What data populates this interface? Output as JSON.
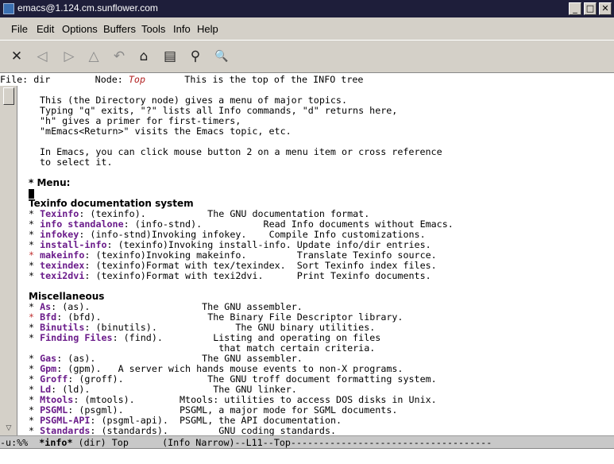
{
  "window": {
    "title": "emacs@1.124.cm.sunflower.com",
    "controls": [
      "_",
      "□",
      "✕"
    ]
  },
  "menubar": [
    "File",
    "Edit",
    "Options",
    "Buffers",
    "Tools",
    "Info",
    "Help"
  ],
  "toolbar": [
    {
      "icon": "close-icon",
      "glyph": "✕",
      "enabled": true
    },
    {
      "icon": "prev-node-icon",
      "glyph": "◁",
      "enabled": false
    },
    {
      "icon": "next-node-icon",
      "glyph": "▷",
      "enabled": false
    },
    {
      "icon": "up-node-icon",
      "glyph": "△",
      "enabled": false
    },
    {
      "icon": "back-history-icon",
      "glyph": "↶",
      "enabled": false
    },
    {
      "icon": "home-icon",
      "glyph": "⌂",
      "enabled": true
    },
    {
      "icon": "index-icon",
      "glyph": "▤",
      "enabled": true
    },
    {
      "icon": "goto-node-icon",
      "glyph": "⚲",
      "enabled": true
    },
    {
      "icon": "search-icon",
      "glyph": "🔍",
      "enabled": true
    }
  ],
  "header": {
    "file_label": "File:",
    "file": "dir",
    "node_label": "Node:",
    "node": "Top",
    "description": "This is the top of the INFO tree"
  },
  "intro": [
    "This (the Directory node) gives a menu of major topics.",
    "Typing \"q\" exits, \"?\" lists all Info commands, \"d\" returns here,",
    "\"h\" gives a primer for first-timers,",
    "\"mEmacs<Return>\" visits the Emacs topic, etc.",
    "",
    "In Emacs, you can click mouse button 2 on a menu item or cross reference",
    "to select it."
  ],
  "menu_heading": "* Menu:",
  "sections": [
    {
      "title": "Texinfo documentation system",
      "items": [
        {
          "star_red": false,
          "name": "Texinfo",
          "rest": ": (texinfo).           The GNU documentation format."
        },
        {
          "star_red": false,
          "name": "info standalone",
          "rest": ": (info-stnd).           Read Info documents without Emacs."
        },
        {
          "star_red": false,
          "name": "infokey",
          "rest": ": (info-stnd)Invoking infokey.    Compile Info customizations."
        },
        {
          "star_red": false,
          "name": "install-info",
          "rest": ": (texinfo)Invoking install-info. Update info/dir entries."
        },
        {
          "star_red": true,
          "name": "makeinfo",
          "rest": ": (texinfo)Invoking makeinfo.         Translate Texinfo source."
        },
        {
          "star_red": false,
          "name": "texindex",
          "rest": ": (texinfo)Format with tex/texindex.  Sort Texinfo index files."
        },
        {
          "star_red": false,
          "name": "texi2dvi",
          "rest": ": (texinfo)Format with texi2dvi.      Print Texinfo documents."
        }
      ]
    },
    {
      "title": "Miscellaneous",
      "items": [
        {
          "star_red": false,
          "name": "As",
          "rest": ": (as).                    The GNU assembler."
        },
        {
          "star_red": true,
          "name": "Bfd",
          "rest": ": (bfd).                   The Binary File Descriptor library."
        },
        {
          "star_red": false,
          "name": "Binutils",
          "rest": ": (binutils).              The GNU binary utilities."
        },
        {
          "star_red": false,
          "name": "Finding Files",
          "rest": ": (find).         Listing and operating on files"
        },
        {
          "star_red": false,
          "name": "",
          "rest": "                                  that match certain criteria."
        },
        {
          "star_red": false,
          "name": "Gas",
          "rest": ": (as).                   The GNU assembler."
        },
        {
          "star_red": false,
          "name": "Gpm",
          "rest": ": (gpm).   A server wich hands mouse events to non-X programs."
        },
        {
          "star_red": false,
          "name": "Groff",
          "rest": ": (groff).               The GNU troff document formatting system."
        },
        {
          "star_red": false,
          "name": "Ld",
          "rest": ": (ld).                      The GNU linker."
        },
        {
          "star_red": false,
          "name": "Mtools",
          "rest": ": (mtools).        Mtools: utilities to access DOS disks in Unix."
        },
        {
          "star_red": false,
          "name": "PSGML",
          "rest": ": (psgml).          PSGML, a major mode for SGML documents."
        },
        {
          "star_red": false,
          "name": "PSGML-API",
          "rest": ": (psgml-api).  PSGML, the API documentation."
        },
        {
          "star_red": false,
          "name": "Standards",
          "rest": ": (standards).         GNU coding standards."
        }
      ]
    }
  ],
  "modeline": {
    "left": "-u:%%  ",
    "buffer": "*info*",
    "rest": " (dir) Top      (Info Narrow)--L11--Top------------------------------------"
  },
  "minibuffer": ""
}
